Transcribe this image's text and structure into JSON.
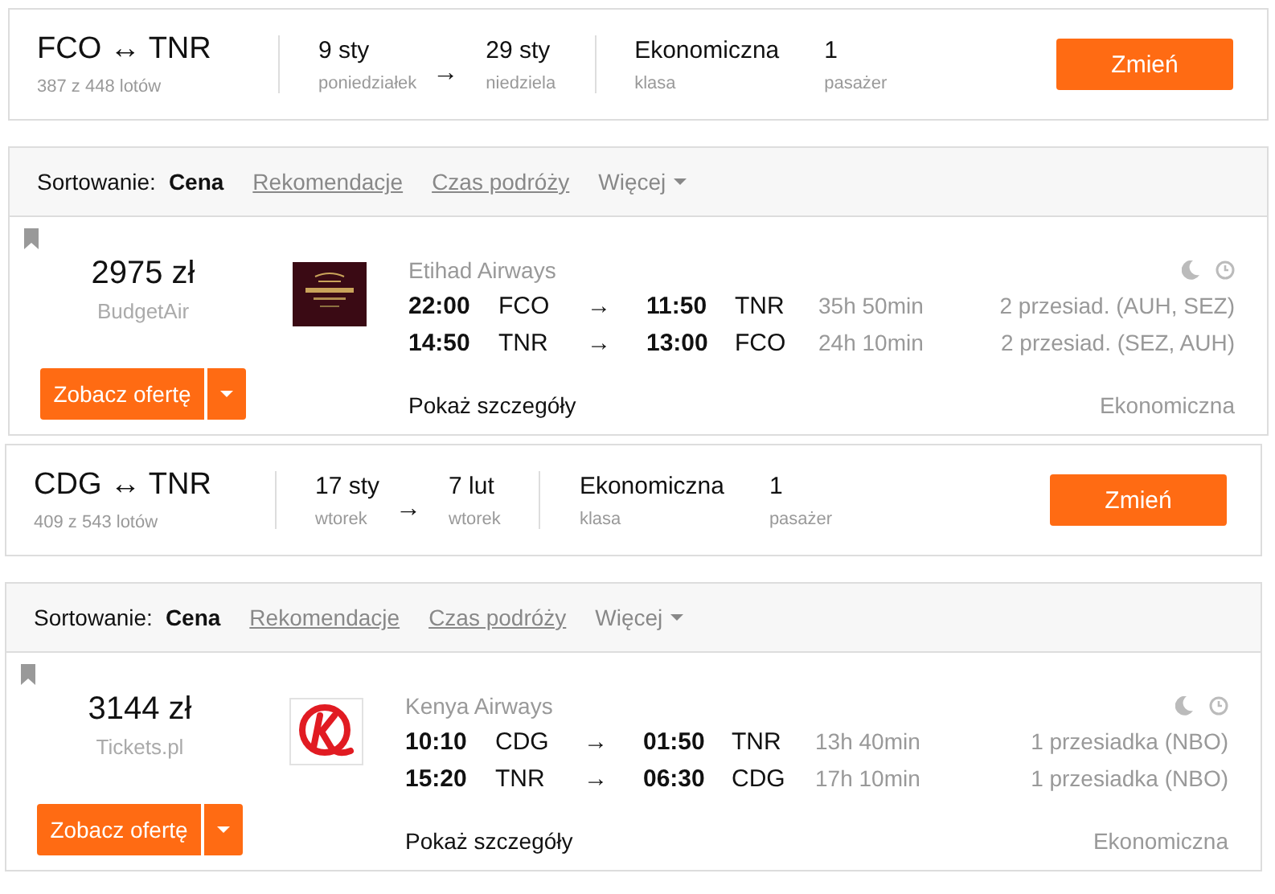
{
  "searches": [
    {
      "header": {
        "route": "FCO ↔ TNR",
        "flights_count": "387 z 448 lotów",
        "depart_date": "9 sty",
        "depart_day": "poniedziałek",
        "date_arrow": "→",
        "return_date": "29 sty",
        "return_day": "niedziela",
        "cabin": "Ekonomiczna",
        "cabin_label": "klasa",
        "passengers": "1",
        "passengers_label": "pasażer",
        "change_button": "Zmień"
      },
      "sort": {
        "label": "Sortowanie:",
        "options": [
          {
            "label": "Cena",
            "selected": true
          },
          {
            "label": "Rekomendacje",
            "selected": false
          },
          {
            "label": "Czas podróży",
            "selected": false
          }
        ],
        "more": "Więcej"
      },
      "result": {
        "price": "2975 zł",
        "agency": "BudgetAir",
        "airline": "Etihad Airways",
        "kind": "etihad",
        "offer_button": "Zobacz ofertę",
        "details_link": "Pokaż szczegóły",
        "cabin": "Ekonomiczna",
        "legs": [
          {
            "depart_time": "22:00",
            "from": "FCO",
            "arrow": "→",
            "arrive_time": "11:50",
            "to": "TNR",
            "duration": "35h 50min",
            "stops": "2 przesiad. (AUH, SEZ)"
          },
          {
            "depart_time": "14:50",
            "from": "TNR",
            "arrow": "→",
            "arrive_time": "13:00",
            "to": "FCO",
            "duration": "24h 10min",
            "stops": "2 przesiad. (SEZ, AUH)"
          }
        ]
      }
    },
    {
      "header": {
        "route": "CDG ↔ TNR",
        "flights_count": "409 z 543 lotów",
        "depart_date": "17 sty",
        "depart_day": "wtorek",
        "date_arrow": "→",
        "return_date": "7 lut",
        "return_day": "wtorek",
        "cabin": "Ekonomiczna",
        "cabin_label": "klasa",
        "passengers": "1",
        "passengers_label": "pasażer",
        "change_button": "Zmień"
      },
      "sort": {
        "label": "Sortowanie:",
        "options": [
          {
            "label": "Cena",
            "selected": true
          },
          {
            "label": "Rekomendacje",
            "selected": false
          },
          {
            "label": "Czas podróży",
            "selected": false
          }
        ],
        "more": "Więcej"
      },
      "result": {
        "price": "3144 zł",
        "agency": "Tickets.pl",
        "airline": "Kenya Airways",
        "kind": "kenya",
        "offer_button": "Zobacz ofertę",
        "details_link": "Pokaż szczegóły",
        "cabin": "Ekonomiczna",
        "legs": [
          {
            "depart_time": "10:10",
            "from": "CDG",
            "arrow": "→",
            "arrive_time": "01:50",
            "to": "TNR",
            "duration": "13h 40min",
            "stops": "1 przesiadka (NBO)"
          },
          {
            "depart_time": "15:20",
            "from": "TNR",
            "arrow": "→",
            "arrive_time": "06:30",
            "to": "CDG",
            "duration": "17h 10min",
            "stops": "1 przesiadka (NBO)"
          }
        ]
      }
    }
  ]
}
